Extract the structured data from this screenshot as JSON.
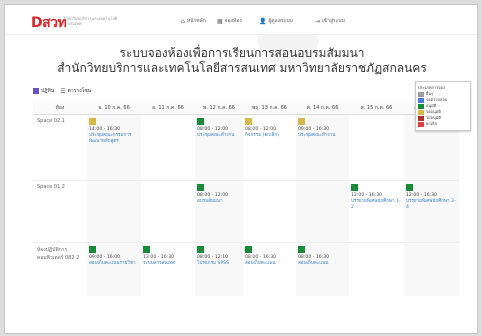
{
  "brand": {
    "logo_text": "Dสวท",
    "logo_subtitle": "สำนักวิทยบริการและเทคโนโลยีสารสนเทศ"
  },
  "nav": [
    {
      "icon": "home-icon",
      "glyph": "⌂",
      "label": "หน้าหลัก"
    },
    {
      "icon": "calendar-icon",
      "glyph": "▦",
      "label": "จองห้อง"
    },
    {
      "icon": "user-icon",
      "glyph": "👤",
      "label": "ผู้ดูแลระบบ"
    },
    {
      "icon": "login-icon",
      "glyph": "⇥",
      "label": "เข้าสู่ระบบ"
    }
  ],
  "title_line1": "ระบบจองห้องเพื่อการเรียนการสอนอบรมสัมมนา",
  "title_line2": "สำนักวิทยบริการและเทคโนโลยีสารสนเทศ มหาวิทยาลัยราชภัฏสกลนคร",
  "view_tabs": {
    "calendar": "ปฏิทิน",
    "table": "ตารางโซน"
  },
  "legend": {
    "title": "ประเภทการจอง",
    "items": [
      {
        "label": "อื่นๆ",
        "color": "#9e9e9e"
      },
      {
        "label": "รอตรวจสอบ",
        "color": "#4a7fd6"
      },
      {
        "label": "อนุมัติ",
        "color": "#1a8a3a"
      },
      {
        "label": "รออนุมัติ",
        "color": "#d4b84a"
      },
      {
        "label": "ไม่อนุมัติ",
        "color": "#b03030"
      },
      {
        "label": "ยกเลิก",
        "color": "#e04040"
      }
    ]
  },
  "table": {
    "columns": [
      "ห้อง",
      "จ. 10 ก.ค. 66",
      "อ. 11 ก.ค. 66",
      "พ. 12 ก.ค. 66",
      "พฤ. 13 ก.ค. 66",
      "ศ. 14 ก.ค. 66",
      "ส. 15 ก.ค. 66",
      "อา. 16 ก.ค. 66"
    ],
    "rows": [
      {
        "room": "Space 02 1",
        "cells": [
          {
            "color": "#d4b84a",
            "time": "14:00 - 16:30",
            "subj": "ประชุมคณะกรรมการพัฒนาหลักสูตร"
          },
          null,
          {
            "color": "#1a8a3a",
            "time": "08:00 - 12:00",
            "subj": "ประชุมคณะทำงาน"
          },
          {
            "color": "#d4b84a",
            "time": "08:00 - 12:00",
            "subj": "กิจกรรม (ยกเลิก)"
          },
          {
            "color": "#d4b84a",
            "time": "09:00 - 16:30",
            "subj": "ประชุมคณะทำงาน"
          },
          null,
          null
        ]
      },
      {
        "room": "Space 01 2",
        "cells": [
          null,
          null,
          {
            "color": "#1a8a3a",
            "time": "08:00 - 12:00",
            "subj": "อบรมสัมมนา"
          },
          null,
          null,
          {
            "color": "#1a8a3a",
            "time": "12:00 - 16:30",
            "subj": "บรรยายพิเศษนักศึกษา 1-2"
          },
          {
            "color": "#1a8a3a",
            "time": "12:00 - 16:30",
            "subj": "บรรยายพิเศษนักศึกษา 3-4"
          }
        ]
      },
      {
        "room": "ห้องปฏิบัติการคอมพิวเตอร์ 082 2",
        "cells": [
          {
            "color": "#1a8a3a",
            "time": "09:00 - 16:00",
            "subj": "สอบเก็บคะแนนรายวิชา"
          },
          {
            "color": "#1a8a3a",
            "time": "13:00 - 16:30",
            "subj": "ระบบสารสนเทศ"
          },
          {
            "color": "#1a8a3a",
            "time": "08:00 - 12:10",
            "subj": "โปรแกรม SPSS"
          },
          {
            "color": "#1a8a3a",
            "time": "08:00 - 16:30",
            "subj": "สอบเก็บคะแนน"
          },
          {
            "color": "#1a8a3a",
            "time": "08:00 - 16:30",
            "subj": "สอบเก็บคะแนน"
          },
          null,
          null
        ]
      }
    ]
  }
}
